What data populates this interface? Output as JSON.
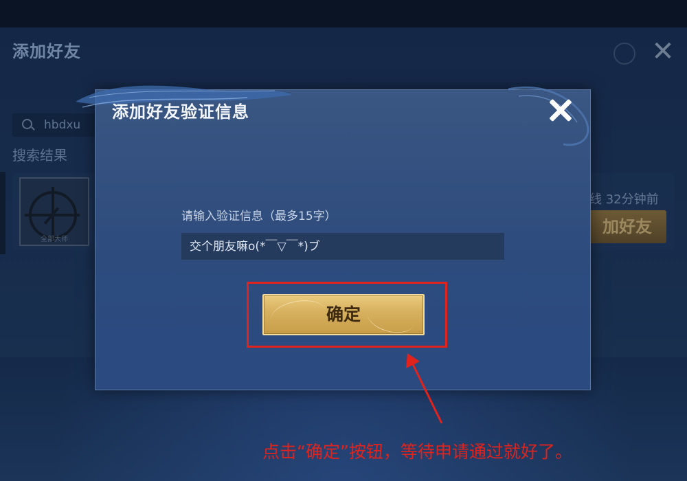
{
  "background": {
    "title": "添加好友",
    "search": {
      "value": "hbdxu"
    },
    "results_label": "搜索结果",
    "result": {
      "avatar_caption": "全部大师",
      "status": "线  32分钟前",
      "add_button": "加好友"
    }
  },
  "dialog": {
    "title": "添加好友验证信息",
    "field_label": "请输入验证信息（最多15字）",
    "field_value": "交个朋友嘛o(*￣▽￣*)ブ",
    "confirm_label": "确定"
  },
  "annotation": {
    "text": "点击“确定”按钮，等待申请通过就好了。",
    "color": "#e0231c"
  },
  "colors": {
    "dialog_bg": "#2d4b7d",
    "button_gold": "#d8b260",
    "page_bg": "#0b1526"
  },
  "icons": [
    "search-icon",
    "close-icon",
    "settings-icon"
  ]
}
